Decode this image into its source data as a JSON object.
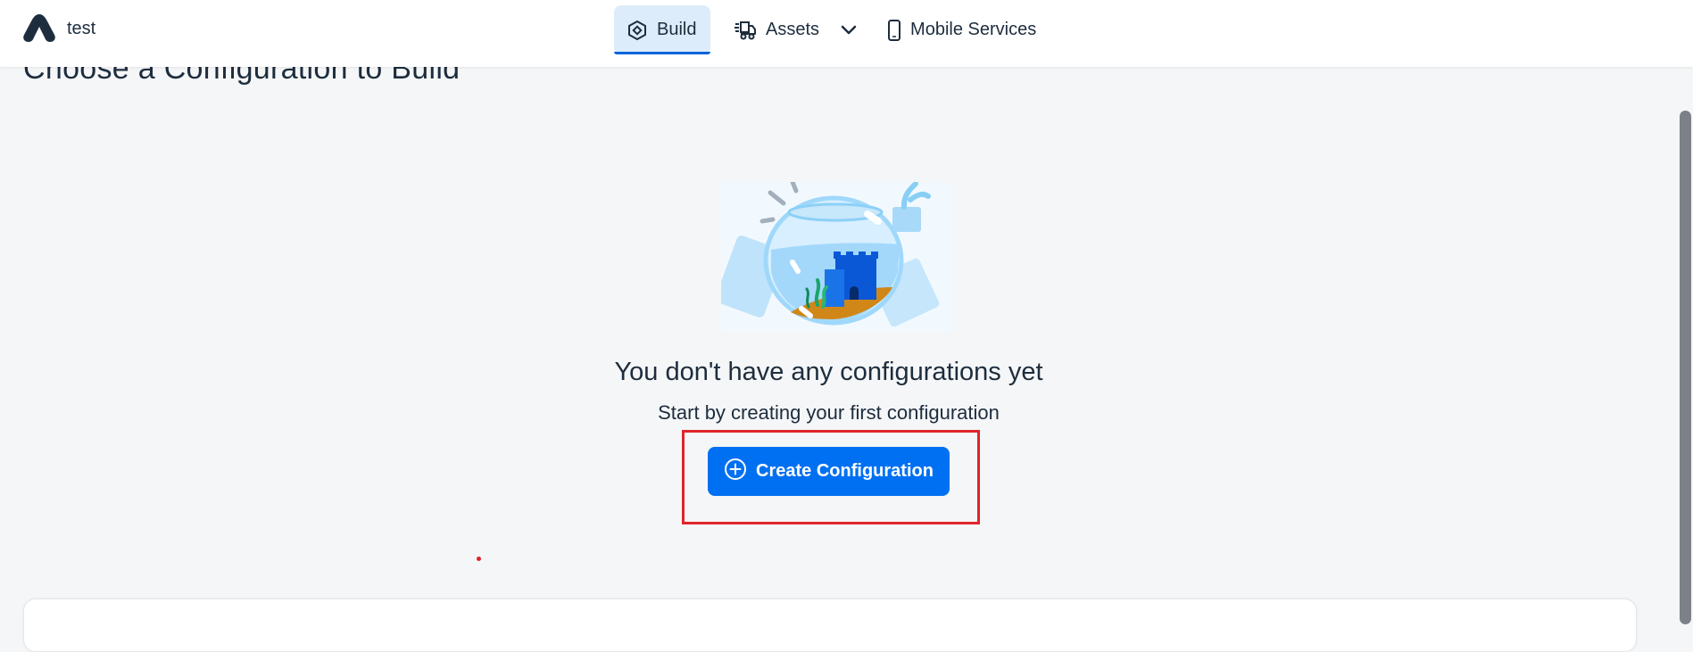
{
  "header": {
    "app_name": "test",
    "nav": [
      {
        "label": "Build",
        "icon": "build-icon",
        "active": true
      },
      {
        "label": "Assets",
        "icon": "assets-truck-icon",
        "has_dropdown": true
      },
      {
        "label": "Mobile Services",
        "icon": "mobile-phone-icon"
      }
    ]
  },
  "main": {
    "title": "Choose a Configuration to Build",
    "empty_state": {
      "illustration": "fishbowl-castle-illustration",
      "title": "You don't have any configurations yet",
      "subtitle": "Start by creating your first configuration",
      "button_label": "Create Configuration",
      "button_icon": "add-circle-icon"
    }
  },
  "colors": {
    "primary": "#0070f2",
    "active_nav_bg": "#dcecfa",
    "active_nav_indicator": "#0064d9",
    "highlight": "#e0242b",
    "background": "#f5f6f7",
    "text": "#1d2d3e"
  }
}
